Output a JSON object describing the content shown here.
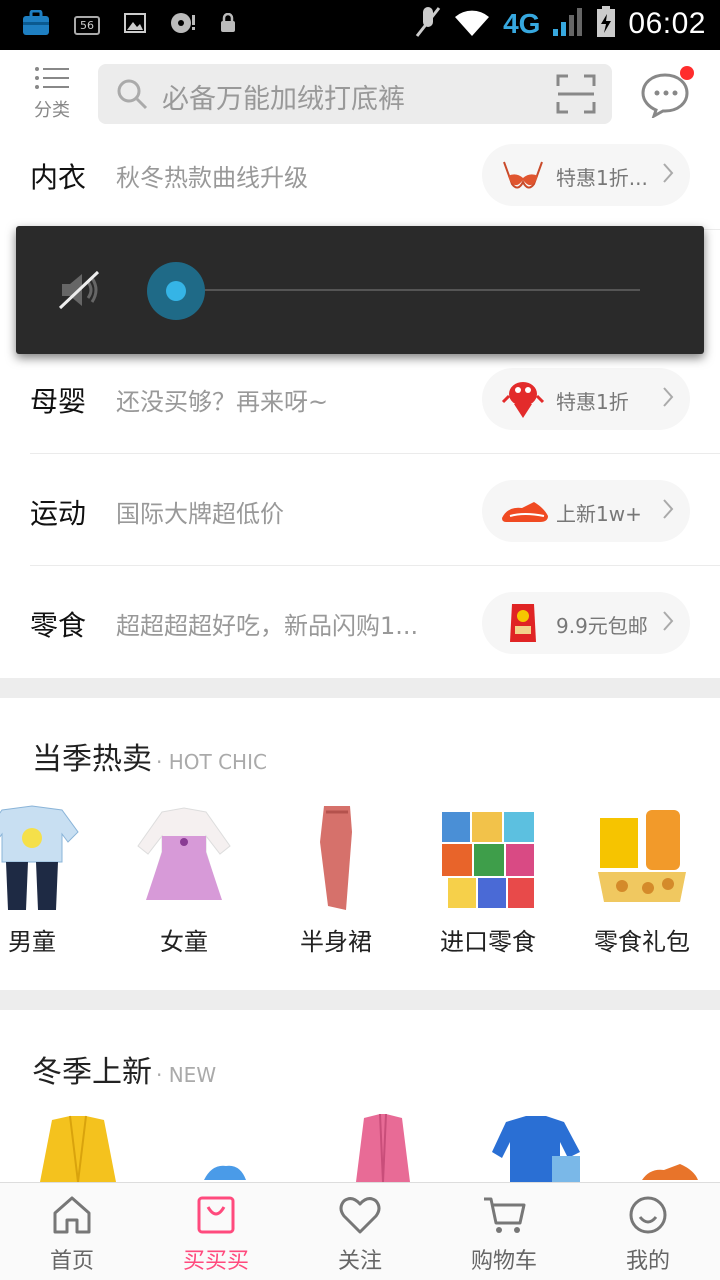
{
  "status_bar": {
    "time": "06:02",
    "network": "4G",
    "badge": "56"
  },
  "topbar": {
    "category_label": "分类",
    "search_placeholder": "必备万能加绒打底裤"
  },
  "categories": [
    {
      "name": "内衣",
      "desc": "秋冬热款曲线升级",
      "tag": "特惠1折..."
    },
    {
      "name": "母婴",
      "desc": "还没买够？再来呀~",
      "tag": "特惠1折"
    },
    {
      "name": "运动",
      "desc": "国际大牌超低价",
      "tag": "上新1w+"
    },
    {
      "name": "零食",
      "desc": "超超超超好吃，新品闪购1...",
      "tag": "9.9元包邮"
    }
  ],
  "hot_section": {
    "title": "当季热卖",
    "subtitle": "· HOT CHIC",
    "items": [
      {
        "label": "男童"
      },
      {
        "label": "女童"
      },
      {
        "label": "半身裙"
      },
      {
        "label": "进口零食"
      },
      {
        "label": "零食礼包"
      }
    ]
  },
  "new_section": {
    "title": "冬季上新",
    "subtitle": "· NEW"
  },
  "bottom_nav": [
    {
      "label": "首页",
      "icon": "home-icon"
    },
    {
      "label": "买买买",
      "icon": "shopping-bag-icon",
      "active": true
    },
    {
      "label": "关注",
      "icon": "heart-icon"
    },
    {
      "label": "购物车",
      "icon": "cart-icon"
    },
    {
      "label": "我的",
      "icon": "profile-icon"
    }
  ],
  "volume_overlay": {
    "muted": true,
    "level": 0
  },
  "colors": {
    "accent": "#ff4a7d",
    "volume_knob": "#35b4e6",
    "notify_dot": "#ff2d2d"
  }
}
